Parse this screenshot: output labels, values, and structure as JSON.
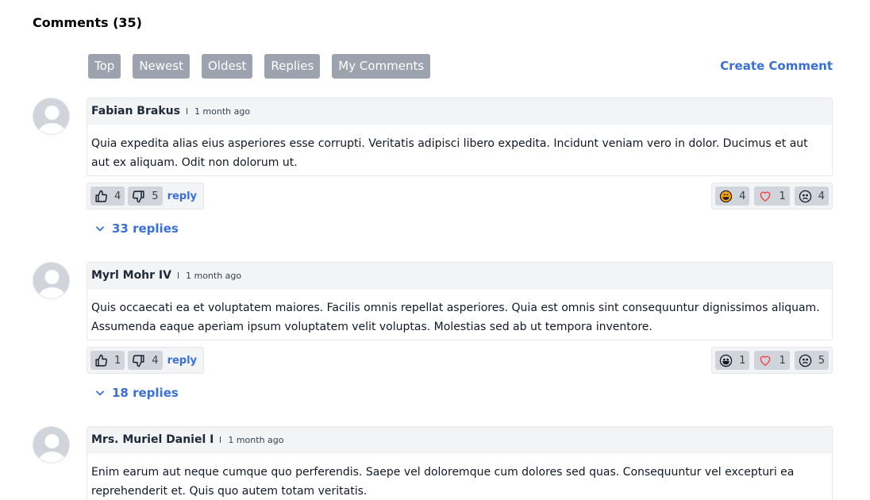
{
  "header": {
    "title": "Comments (35)"
  },
  "filters": [
    {
      "label": "Top"
    },
    {
      "label": "Newest"
    },
    {
      "label": "Oldest"
    },
    {
      "label": "Replies"
    },
    {
      "label": "My Comments"
    }
  ],
  "create_label": "Create Comment",
  "comments": [
    {
      "author": "Fabian Brakus",
      "time": "1 month ago",
      "body": "Quia expedita alias eius asperiores esse corrupti. Veritatis adipisci libero expedita. Incidunt veniam vero in dolor. Ducimus et aut aut ex aliquam. Odit non dolorum ut.",
      "upvotes": "4",
      "downvotes": "5",
      "reply_label": "reply",
      "reactions": {
        "laugh": "4",
        "heart": "1",
        "sad": "4"
      },
      "replies_label": "33 replies"
    },
    {
      "author": "Myrl Mohr IV",
      "time": "1 month ago",
      "body": "Quis occaecati ea et voluptatem maiores. Facilis omnis repellat asperiores. Quia est omnis sint consequuntur dignissimos aliquam. Assumenda eaque aperiam ipsum voluptatem velit voluptas. Molestias sed ab ut tempora inventore.",
      "upvotes": "1",
      "downvotes": "4",
      "reply_label": "reply",
      "reactions": {
        "laugh": "1",
        "heart": "1",
        "sad": "5"
      },
      "replies_label": "18 replies"
    },
    {
      "author": "Mrs. Muriel Daniel I",
      "time": "1 month ago",
      "body": "Enim earum aut neque cumque quo perferendis. Saepe vel doloremque cum dolores sed quas. Consequuntur vel excepturi ea reprehenderit et. Quis quo autem totam veritatis."
    }
  ],
  "colors": {
    "accent": "#3b6fd8",
    "filter_bg": "#9ca3af",
    "heart": "#ef4444",
    "laugh": "#f59e0b"
  },
  "icons": [
    "thumbs-up-icon",
    "thumbs-down-icon",
    "laugh-emoji-icon",
    "heart-icon",
    "sad-face-icon",
    "chevron-down-icon",
    "avatar-silhouette"
  ]
}
